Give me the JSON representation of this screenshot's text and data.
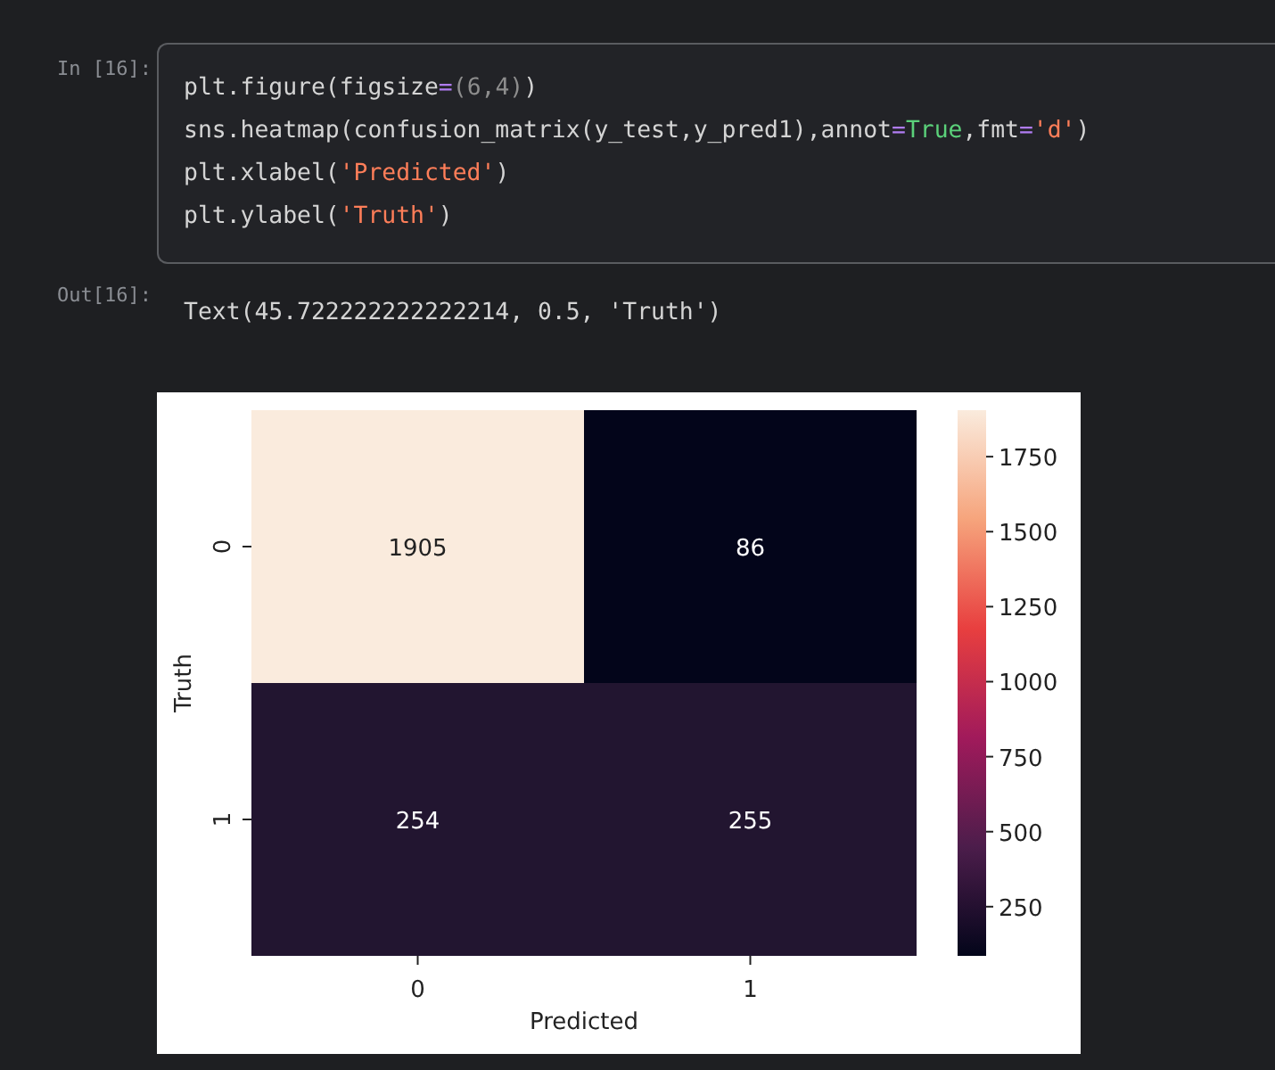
{
  "input_cell": {
    "prompt": "In [16]:",
    "lines": [
      [
        {
          "text": "plt.figure(figsize",
          "kind": "plain"
        },
        {
          "text": "=",
          "kind": "op"
        },
        {
          "text": "(6,4)",
          "kind": "num"
        },
        {
          "text": ")",
          "kind": "plain"
        }
      ],
      [
        {
          "text": "sns.heatmap(confusion_matrix(y_test,y_pred1),annot",
          "kind": "plain"
        },
        {
          "text": "=",
          "kind": "op"
        },
        {
          "text": "True",
          "kind": "kw"
        },
        {
          "text": ",fmt",
          "kind": "plain"
        },
        {
          "text": "=",
          "kind": "op"
        },
        {
          "text": "'d'",
          "kind": "str"
        },
        {
          "text": ")",
          "kind": "plain"
        }
      ],
      [
        {
          "text": "plt.xlabel(",
          "kind": "plain"
        },
        {
          "text": "'Predicted'",
          "kind": "str"
        },
        {
          "text": ")",
          "kind": "plain"
        }
      ],
      [
        {
          "text": "plt.ylabel(",
          "kind": "plain"
        },
        {
          "text": "'Truth'",
          "kind": "str"
        },
        {
          "text": ")",
          "kind": "plain"
        }
      ]
    ]
  },
  "output_cell": {
    "prompt": "Out[16]:",
    "text": "Text(45.722222222222214, 0.5, 'Truth')"
  },
  "heatmap": {
    "xlabel": "Predicted",
    "ylabel": "Truth",
    "xticks": [
      "0",
      "1"
    ],
    "yticks": [
      "0",
      "1"
    ],
    "cells": [
      [
        {
          "value": "1905",
          "color": "#faebdd"
        },
        {
          "value": "86",
          "color": "#03051a"
        }
      ],
      [
        {
          "value": "254",
          "color": "#221530"
        },
        {
          "value": "255",
          "color": "#221530"
        }
      ]
    ],
    "colorbar_ticks": [
      "1750",
      "1500",
      "1250",
      "1000",
      "750",
      "500",
      "250"
    ]
  }
}
